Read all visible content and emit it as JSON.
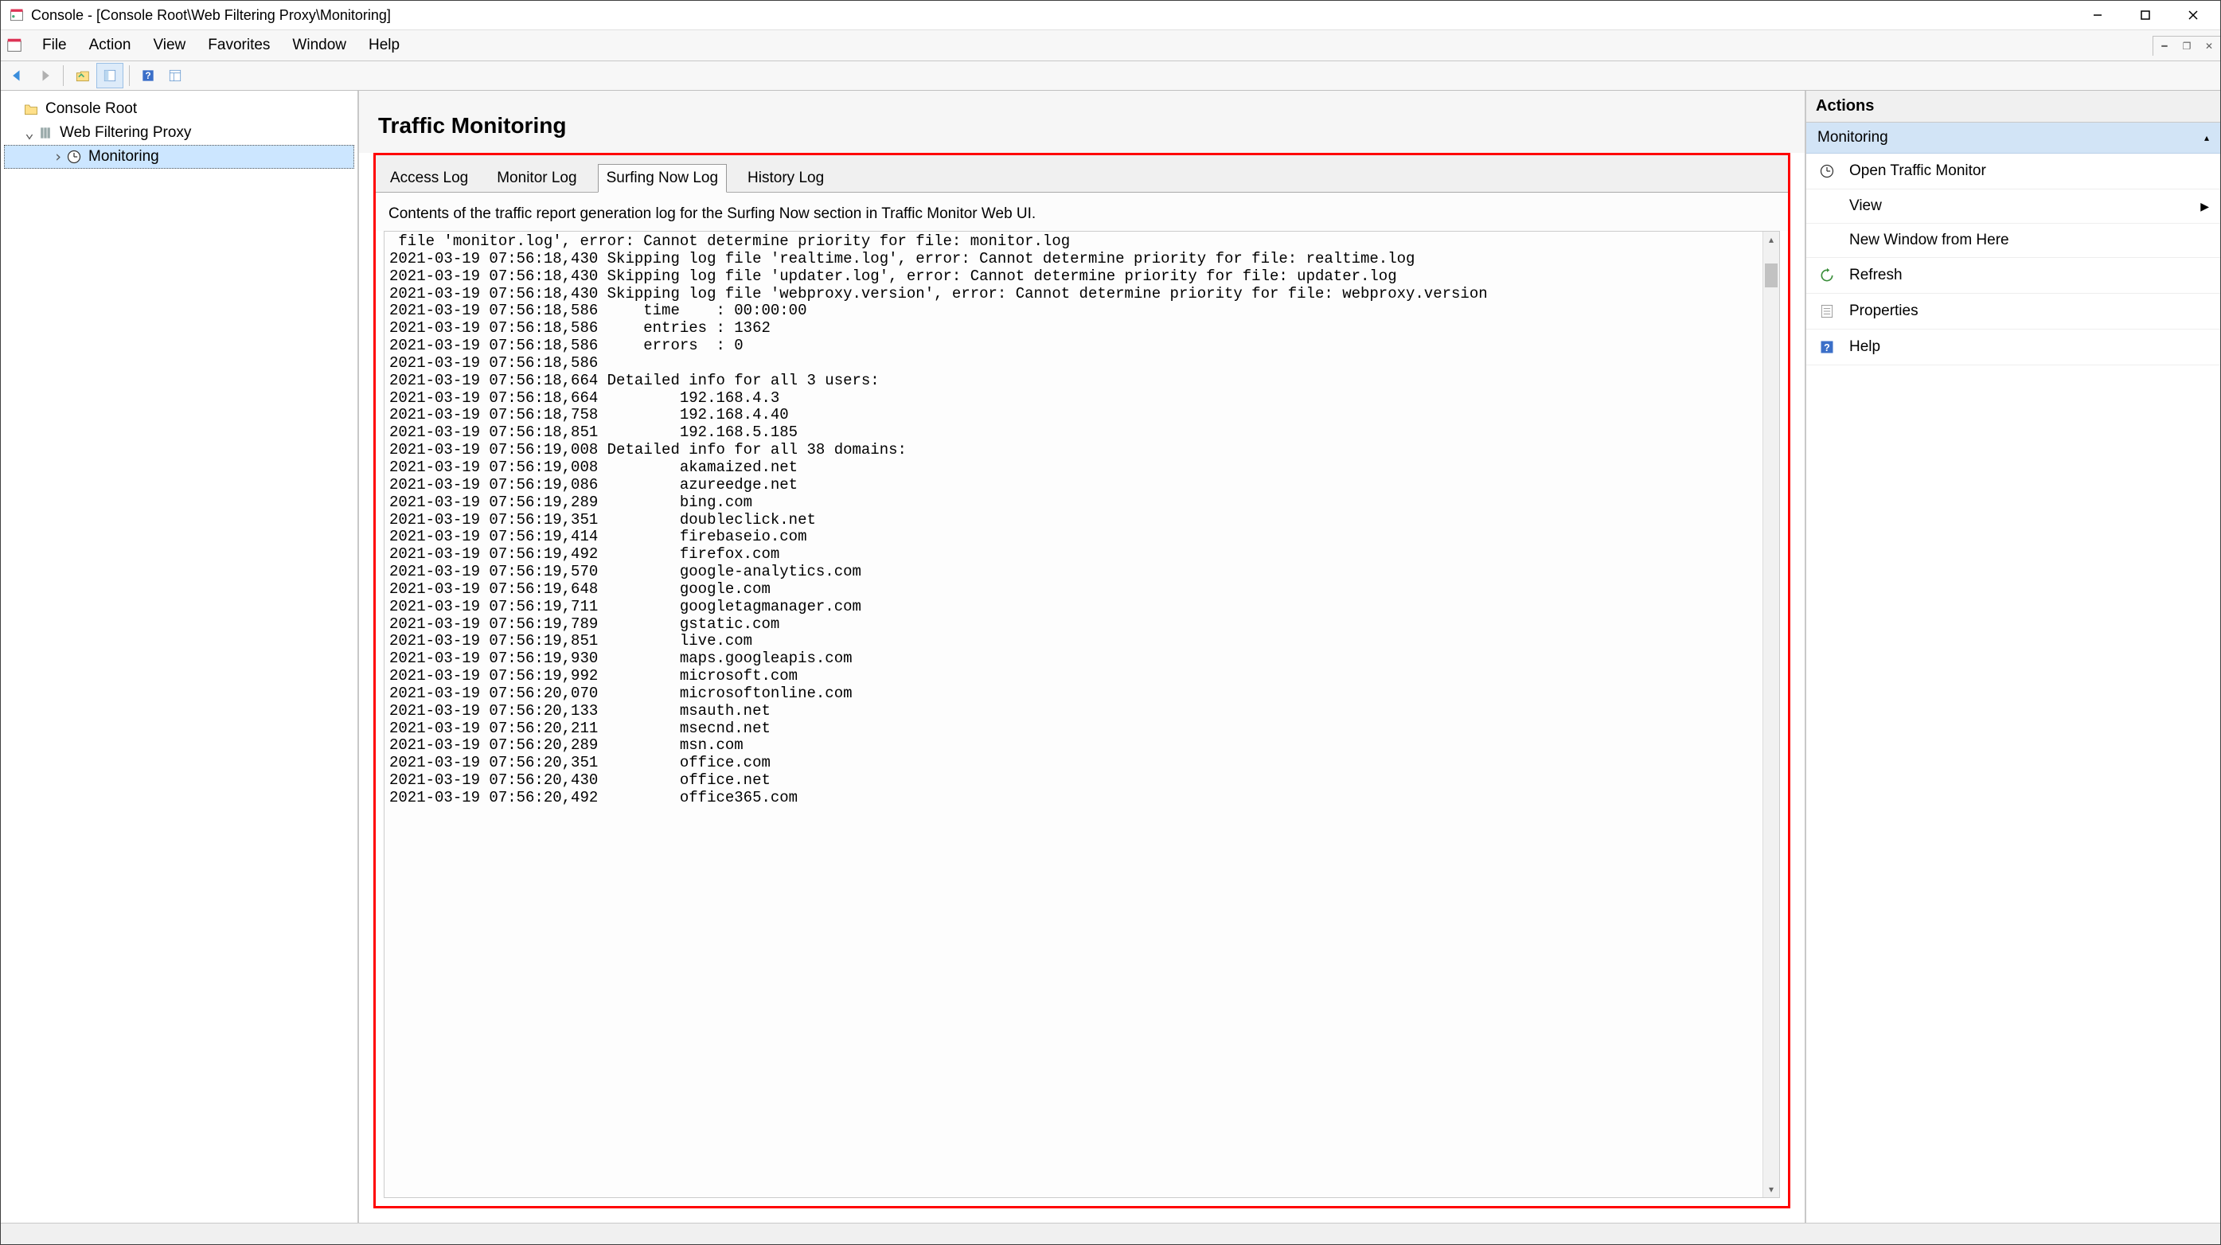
{
  "window": {
    "title": "Console - [Console Root\\Web Filtering Proxy\\Monitoring]"
  },
  "menu": {
    "file": "File",
    "action": "Action",
    "view": "View",
    "favorites": "Favorites",
    "window": "Window",
    "help": "Help"
  },
  "tree": {
    "root": "Console Root",
    "proxy": "Web Filtering Proxy",
    "monitoring": "Monitoring"
  },
  "main": {
    "heading": "Traffic Monitoring",
    "tabs": {
      "access": "Access Log",
      "monitor": "Monitor Log",
      "surfing": "Surfing Now Log",
      "history": "History Log"
    },
    "desc": "Contents of the traffic report generation log for the Surfing Now section in Traffic Monitor Web UI.",
    "log": " file 'monitor.log', error: Cannot determine priority for file: monitor.log\n2021-03-19 07:56:18,430 Skipping log file 'realtime.log', error: Cannot determine priority for file: realtime.log\n2021-03-19 07:56:18,430 Skipping log file 'updater.log', error: Cannot determine priority for file: updater.log\n2021-03-19 07:56:18,430 Skipping log file 'webproxy.version', error: Cannot determine priority for file: webproxy.version\n2021-03-19 07:56:18,586     time    : 00:00:00\n2021-03-19 07:56:18,586     entries : 1362\n2021-03-19 07:56:18,586     errors  : 0\n2021-03-19 07:56:18,586\n2021-03-19 07:56:18,664 Detailed info for all 3 users:\n2021-03-19 07:56:18,664         192.168.4.3\n2021-03-19 07:56:18,758         192.168.4.40\n2021-03-19 07:56:18,851         192.168.5.185\n2021-03-19 07:56:19,008 Detailed info for all 38 domains:\n2021-03-19 07:56:19,008         akamaized.net\n2021-03-19 07:56:19,086         azureedge.net\n2021-03-19 07:56:19,289         bing.com\n2021-03-19 07:56:19,351         doubleclick.net\n2021-03-19 07:56:19,414         firebaseio.com\n2021-03-19 07:56:19,492         firefox.com\n2021-03-19 07:56:19,570         google-analytics.com\n2021-03-19 07:56:19,648         google.com\n2021-03-19 07:56:19,711         googletagmanager.com\n2021-03-19 07:56:19,789         gstatic.com\n2021-03-19 07:56:19,851         live.com\n2021-03-19 07:56:19,930         maps.googleapis.com\n2021-03-19 07:56:19,992         microsoft.com\n2021-03-19 07:56:20,070         microsoftonline.com\n2021-03-19 07:56:20,133         msauth.net\n2021-03-19 07:56:20,211         msecnd.net\n2021-03-19 07:56:20,289         msn.com\n2021-03-19 07:56:20,351         office.com\n2021-03-19 07:56:20,430         office.net\n2021-03-19 07:56:20,492         office365.com"
  },
  "actions": {
    "header": "Actions",
    "group": "Monitoring",
    "open": "Open Traffic Monitor",
    "view": "View",
    "newwindow": "New Window from Here",
    "refresh": "Refresh",
    "properties": "Properties",
    "help": "Help"
  }
}
